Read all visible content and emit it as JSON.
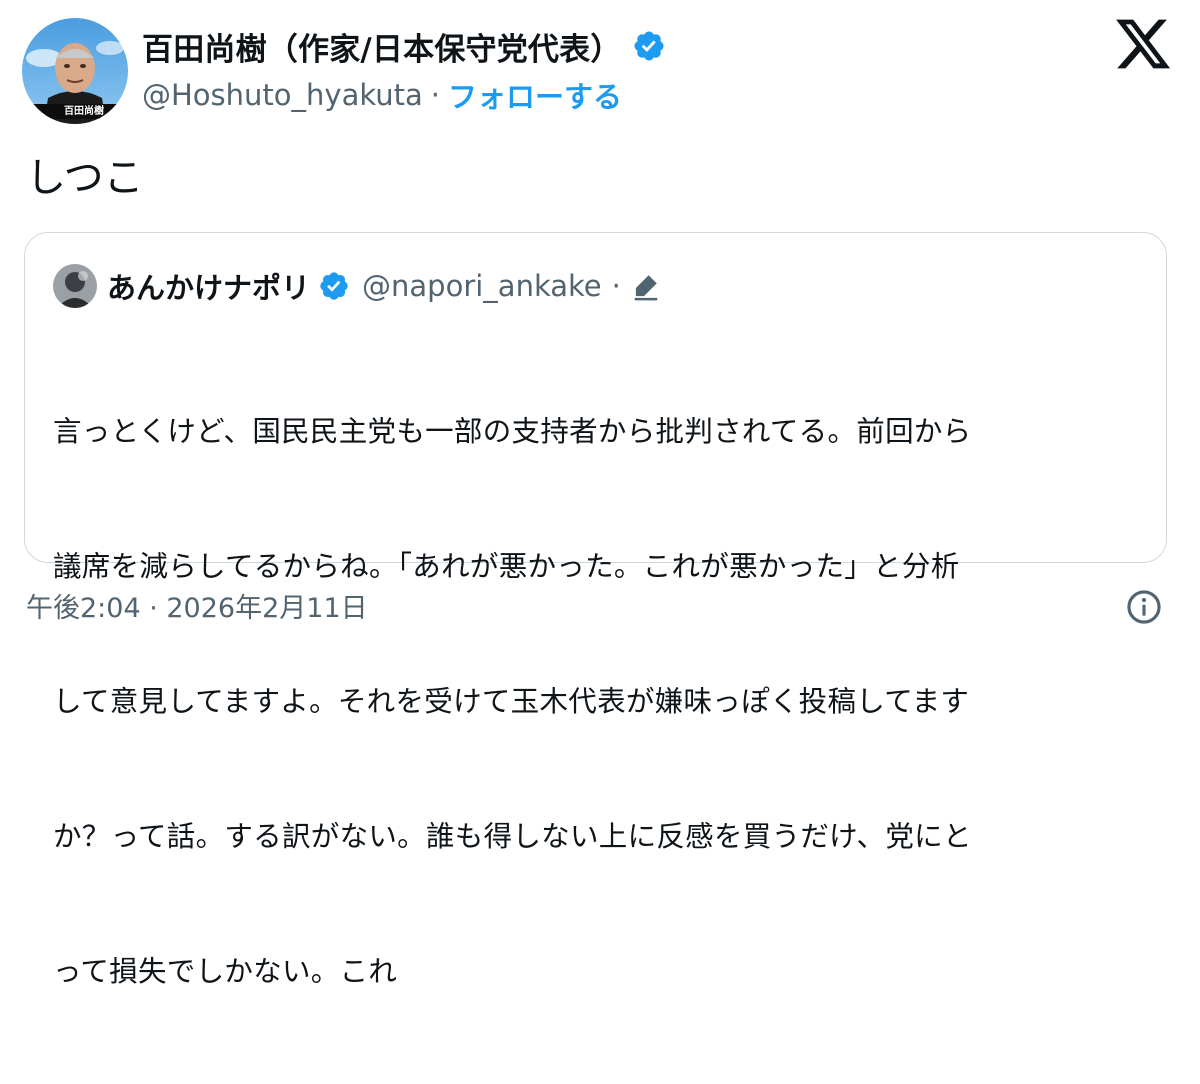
{
  "author": {
    "name": "百田尚樹（作家/日本保守党代表）",
    "handle": "@Hoshuto_hyakuta",
    "separator": "·",
    "follow_label": "フォローする",
    "verified_icon": "verified-badge-icon",
    "avatar_caption": "百田尚樹"
  },
  "tweet": {
    "text": "しつこ"
  },
  "quote": {
    "name": "あんかけナポリ",
    "handle": "@napori_ankake",
    "separator": "·",
    "edit_icon": "edit-pencil-icon",
    "lines": [
      "言っとくけど、国民民主党も一部の支持者から批判されてる。前回から",
      "議席を減らしてるからね。「あれが悪かった。これが悪かった」と分析",
      "して意見してますよ。それを受けて玉木代表が嫌味っぽく投稿してます",
      "か？って話。する訳がない。誰も得しない上に反感を買うだけ、党にと",
      "って損失でしかない。これ"
    ]
  },
  "footer": {
    "timestamp": "午後2:04 · 2026年2月11日",
    "info_icon": "info-icon"
  },
  "colors": {
    "accent": "#1d9bf0",
    "secondary_text": "#536471",
    "border": "#cfd9de"
  }
}
